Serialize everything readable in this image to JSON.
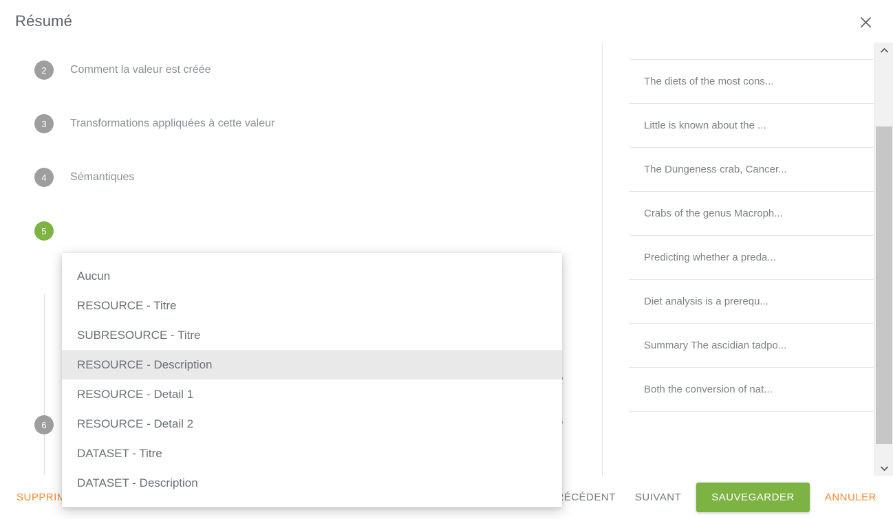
{
  "dialog": {
    "title": "Résumé",
    "close_icon": "close-icon"
  },
  "stepper": {
    "steps": [
      {
        "number": "2",
        "label": "Comment la valeur est créée",
        "state": "inactive"
      },
      {
        "number": "3",
        "label": "Transformations appliquées à cette valeur",
        "state": "inactive"
      },
      {
        "number": "4",
        "label": "Sémantiques",
        "state": "inactive"
      },
      {
        "number": "5",
        "label": "",
        "state": "active"
      },
      {
        "number": "6",
        "label": "",
        "state": "inactive"
      }
    ]
  },
  "select_menu": {
    "selected_value": "RESOURCE - Description",
    "options": [
      "Aucun",
      "RESOURCE - Titre",
      "SUBRESOURCE - Titre",
      "RESOURCE - Description",
      "RESOURCE - Detail 1",
      "RESOURCE - Detail 2",
      "DATASET - Titre",
      "DATASET - Description"
    ]
  },
  "preview": {
    "items": [
      "The diets of the most cons...",
      "Little is known about the ...",
      "The Dungeness crab, Cancer...",
      "Crabs of the genus Macroph...",
      "Predicting whether a preda...",
      "Diet analysis is a prerequ...",
      "Summary The ascidian tadpo...",
      "Both the conversion of nat..."
    ]
  },
  "scrollbar": {
    "up_icon": "chevron-up-icon",
    "down_icon": "chevron-down-icon"
  },
  "footer": {
    "delete_label": "SUPPRIMER",
    "previous_label": "PRÉCÉDENT",
    "next_label": "SUIVANT",
    "save_label": "SAUVEGARDER",
    "cancel_label": "ANNULER"
  },
  "colors": {
    "accent_green": "#7cb342",
    "accent_orange": "#f4892e",
    "badge_grey": "#9e9e9e",
    "highlight_row": "#e9e9e9"
  }
}
